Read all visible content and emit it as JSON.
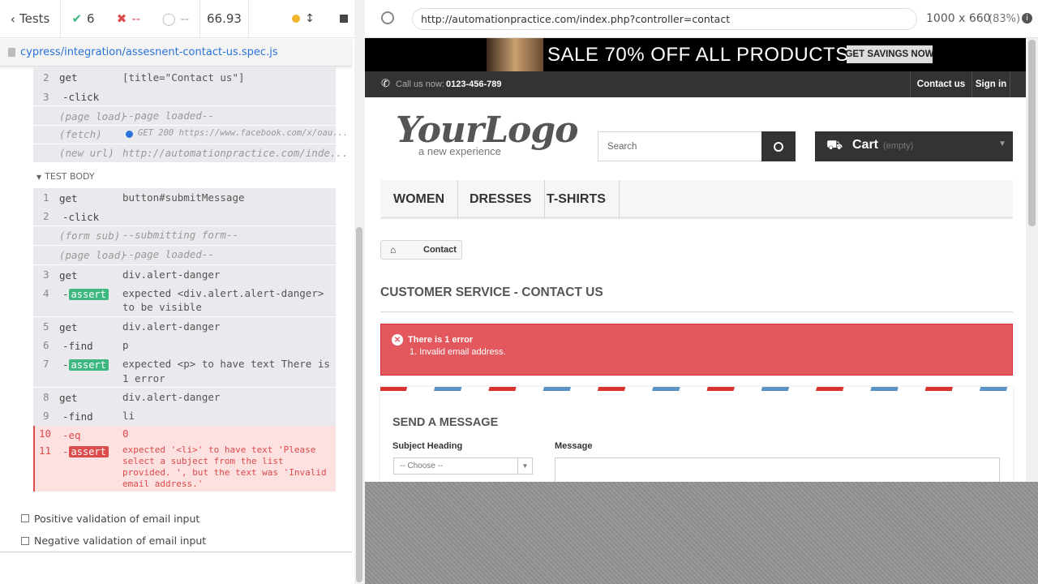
{
  "topbar": {
    "tests_label": "Tests",
    "passed": "6",
    "failed": "--",
    "pending": "--",
    "duration": "66.93"
  },
  "spec": {
    "path": "cypress/integration/assesnent-contact-us.spec.js"
  },
  "before": [
    {
      "n": "2",
      "k": "get",
      "v": "[title=\"Contact us\"]"
    },
    {
      "n": "3",
      "k": "-click",
      "v": ""
    },
    {
      "n": "",
      "k": "(page load)",
      "v": "--page loaded--"
    },
    {
      "n": "",
      "k": "(fetch)",
      "v": "GET 200 https://www.facebook.com/x/oau..."
    },
    {
      "n": "",
      "k": "(new url)",
      "v": "http://automationpractice.com/inde..."
    }
  ],
  "test_body_label": "TEST BODY",
  "body": {
    "c1": {
      "n": "1",
      "k": "get",
      "v": "button#submitMessage"
    },
    "c2": {
      "n": "2",
      "k": "-click",
      "v": ""
    },
    "c3": {
      "k": "(form sub)",
      "v": "--submitting form--"
    },
    "c4": {
      "k": "(page load)",
      "v": "--page loaded--"
    },
    "c5": {
      "n": "3",
      "k": "get",
      "v": "div.alert-danger"
    },
    "c6": {
      "n": "4",
      "k": "-",
      "badge": "assert",
      "l1a": "expected",
      "l1b": "<div.alert.alert-danger>",
      "l2a": "to be",
      "l2b": "visible"
    },
    "c7": {
      "n": "5",
      "k": "get",
      "v": "div.alert-danger"
    },
    "c8": {
      "n": "6",
      "k": "-find",
      "v": "p"
    },
    "c9": {
      "n": "7",
      "k": "-",
      "badge": "assert",
      "l1a": "expected",
      "l1b": "<p>",
      "l1c": "to have text",
      "l1d": "There is",
      "l2": "1 error"
    },
    "c10": {
      "n": "8",
      "k": "get",
      "v": "div.alert-danger"
    },
    "c11": {
      "n": "9",
      "k": "-find",
      "v": "li"
    },
    "c12": {
      "n": "10",
      "k": "-eq",
      "v": "0"
    },
    "c13": {
      "n": "11",
      "k": "-",
      "badge": "assert",
      "l1": "expected '<li>' to have text 'Please",
      "l2": "select a subject from the list",
      "l3": "provided. ', but the text was 'Invalid",
      "l4": "email address.'"
    }
  },
  "other_tests": [
    "Positive validation of email input",
    "Negative validation of email input"
  ],
  "browser": {
    "url": "http://automationpractice.com/index.php?controller=contact",
    "viewport": "1000 x 660",
    "scale": "(83%)"
  },
  "site": {
    "banner_text": "SALE 70% OFF ALL PRODUCTS",
    "banner_button": "GET SAVINGS NOW",
    "call_label": "Call us now:",
    "phone": "0123-456-789",
    "contact_link": "Contact us",
    "signin_link": "Sign in",
    "logo_main": "YourLogo",
    "logo_tag": "a new experience",
    "search_placeholder": "Search",
    "cart_label": "Cart",
    "cart_state": "(empty)",
    "menu": [
      "WOMEN",
      "DRESSES",
      "T-SHIRTS"
    ],
    "breadcrumb": "Contact",
    "heading": "CUSTOMER SERVICE - CONTACT US",
    "error_title": "There is 1 error",
    "error_item": "1. Invalid email address.",
    "send_heading": "SEND A MESSAGE",
    "subject_label": "Subject Heading",
    "subject_value": "-- Choose --",
    "message_label": "Message"
  },
  "colors": {
    "pass": "#3eb880",
    "fail": "#db4b4b",
    "alert": "#e3585c",
    "link": "#2a72d8"
  }
}
